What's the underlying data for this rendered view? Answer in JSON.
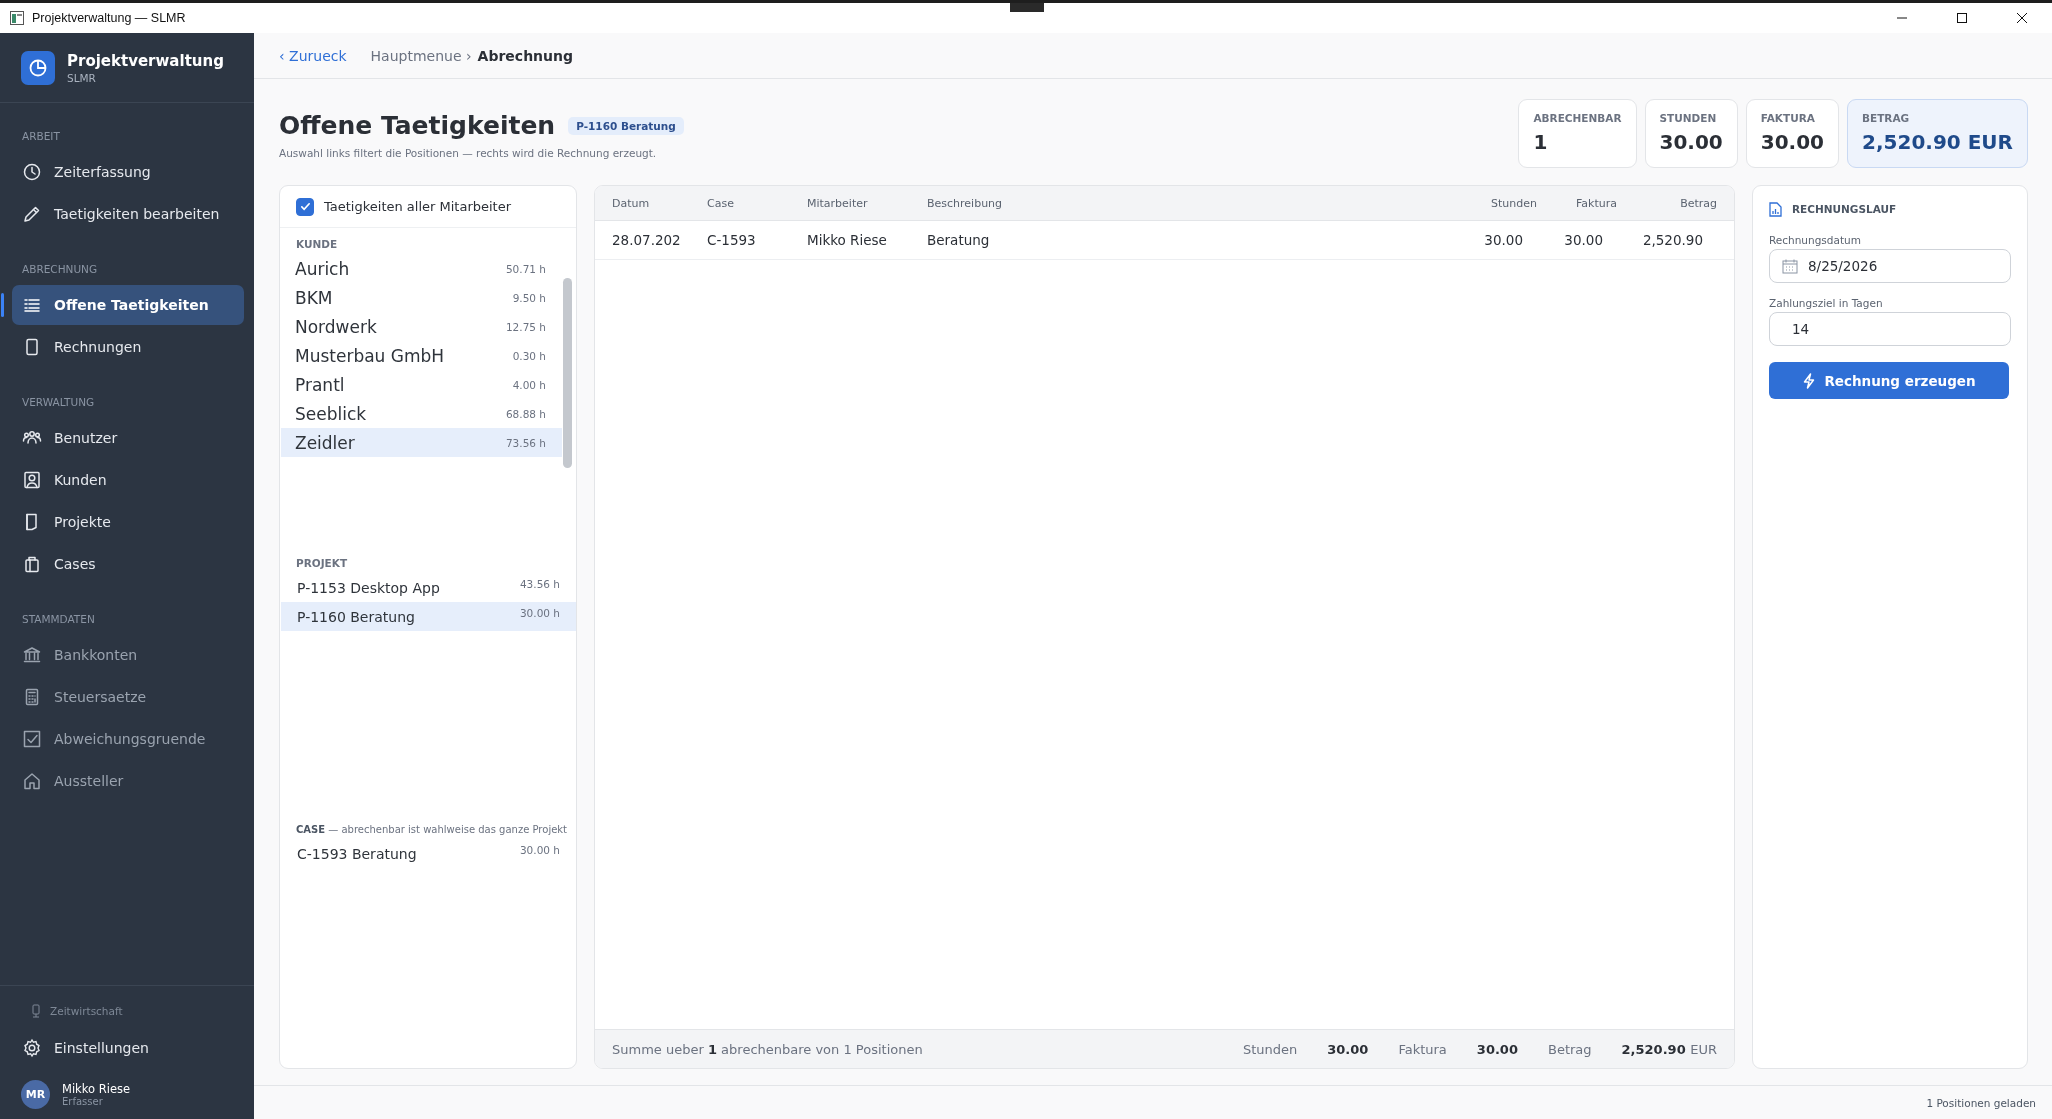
{
  "window": {
    "title": "Projektverwaltung — SLMR"
  },
  "sidebar": {
    "app_name": "Projektverwaltung",
    "app_sub": "SLMR",
    "sections": [
      {
        "label": "ARBEIT",
        "items": [
          {
            "label": "Zeiterfassung",
            "selected": false,
            "disabled": false
          },
          {
            "label": "Taetigkeiten bearbeiten",
            "selected": false,
            "disabled": false
          }
        ]
      },
      {
        "label": "ABRECHNUNG",
        "items": [
          {
            "label": "Offene Taetigkeiten",
            "selected": true,
            "disabled": false
          },
          {
            "label": "Rechnungen",
            "selected": false,
            "disabled": false
          }
        ]
      },
      {
        "label": "VERWALTUNG",
        "items": [
          {
            "label": "Benutzer",
            "selected": false,
            "disabled": false
          },
          {
            "label": "Kunden",
            "selected": false,
            "disabled": false
          },
          {
            "label": "Projekte",
            "selected": false,
            "disabled": false
          },
          {
            "label": "Cases",
            "selected": false,
            "disabled": false
          }
        ]
      },
      {
        "label": "STAMMDATEN",
        "items": [
          {
            "label": "Bankkonten",
            "selected": false,
            "disabled": true
          },
          {
            "label": "Steuersaetze",
            "selected": false,
            "disabled": true
          },
          {
            "label": "Abweichungsgruende",
            "selected": false,
            "disabled": true
          },
          {
            "label": "Aussteller",
            "selected": false,
            "disabled": true
          }
        ]
      }
    ],
    "footer_label": "Zeitwirtschaft",
    "settings": "Einstellungen",
    "user": {
      "initials": "MR",
      "name": "Mikko Riese",
      "role": "Erfasser"
    }
  },
  "breadcrumb": {
    "back": "‹ Zurueck",
    "path": "Hauptmenue ›",
    "current": "Abrechnung"
  },
  "page": {
    "title": "Offene Taetigkeiten",
    "badge": "P-1160 Beratung",
    "subtitle": "Auswahl links filtert die Positionen — rechts wird die Rechnung erzeugt."
  },
  "stats": [
    {
      "label": "ABRECHENBAR",
      "value": "1",
      "highlight": false
    },
    {
      "label": "STUNDEN",
      "value": "30.00",
      "highlight": false
    },
    {
      "label": "FAKTURA",
      "value": "30.00",
      "highlight": false
    },
    {
      "label": "BETRAG",
      "value": "2,520.90 EUR",
      "highlight": true
    }
  ],
  "filter": {
    "all_employees": {
      "label": "Taetigkeiten aller Mitarbeiter",
      "checked": true
    },
    "kunde_heading": "KUNDE",
    "kunden": [
      {
        "name": "Aurich",
        "hours": "50.71 h",
        "selected": false
      },
      {
        "name": "BKM",
        "hours": "9.50 h",
        "selected": false
      },
      {
        "name": "Nordwerk",
        "hours": "12.75 h",
        "selected": false
      },
      {
        "name": "Musterbau GmbH",
        "hours": "0.30 h",
        "selected": false
      },
      {
        "name": "Prantl",
        "hours": "4.00 h",
        "selected": false
      },
      {
        "name": "Seeblick",
        "hours": "68.88 h",
        "selected": false
      },
      {
        "name": "Zeidler",
        "hours": "73.56 h",
        "selected": true
      }
    ],
    "projekt_heading": "PROJEKT",
    "projekte": [
      {
        "name": "P-1153 Desktop App",
        "hours": "43.56 h",
        "selected": false
      },
      {
        "name": "P-1160 Beratung",
        "hours": "30.00 h",
        "selected": true
      }
    ],
    "case_heading": "**CASE** — abrechenbar ist wahlweise das ganze Projekt",
    "cases": [
      {
        "name": "C-1593 Beratung",
        "hours": "30.00 h",
        "selected": false
      }
    ]
  },
  "table": {
    "columns": [
      "Datum",
      "Case",
      "Mitarbeiter",
      "Beschreibung",
      "Stunden",
      "Faktura",
      "Betrag"
    ],
    "rows": [
      [
        "28.07.202",
        "C-1593",
        "Mikko Riese",
        "Beratung",
        "30.00",
        "30.00",
        "2,520.90"
      ]
    ],
    "footer": {
      "summary": "Summe ueber **1** abrechenbare von 1 Positionen",
      "totals": [
        {
          "label": "Stunden",
          "value": "30.00"
        },
        {
          "label": "Faktura",
          "value": "30.00"
        },
        {
          "label": "Betrag",
          "value": "2,520.90",
          "unit": "EUR"
        }
      ]
    }
  },
  "invoice": {
    "heading": "RECHNUNGSLAUF",
    "date_label": "Rechnungsdatum",
    "date": "8/25/2026",
    "days_label": "Zahlungsziel in Tagen",
    "days": "14",
    "button": "Rechnung erzeugen"
  },
  "status_bar": "1 Positionen geladen"
}
